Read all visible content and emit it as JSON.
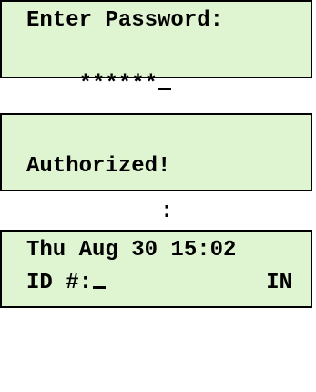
{
  "screens": {
    "password": {
      "line1": "Enter Password:",
      "line2_masked": "******"
    },
    "authorized": {
      "line1": "",
      "line2": "Authorized!"
    },
    "separator": ":",
    "home": {
      "datetime": "Thu Aug 30 15:02",
      "id_label": "ID #:",
      "status": "IN"
    }
  },
  "colors": {
    "lcd_background": "#dff4d1",
    "lcd_border": "#000000",
    "text": "#000000"
  }
}
